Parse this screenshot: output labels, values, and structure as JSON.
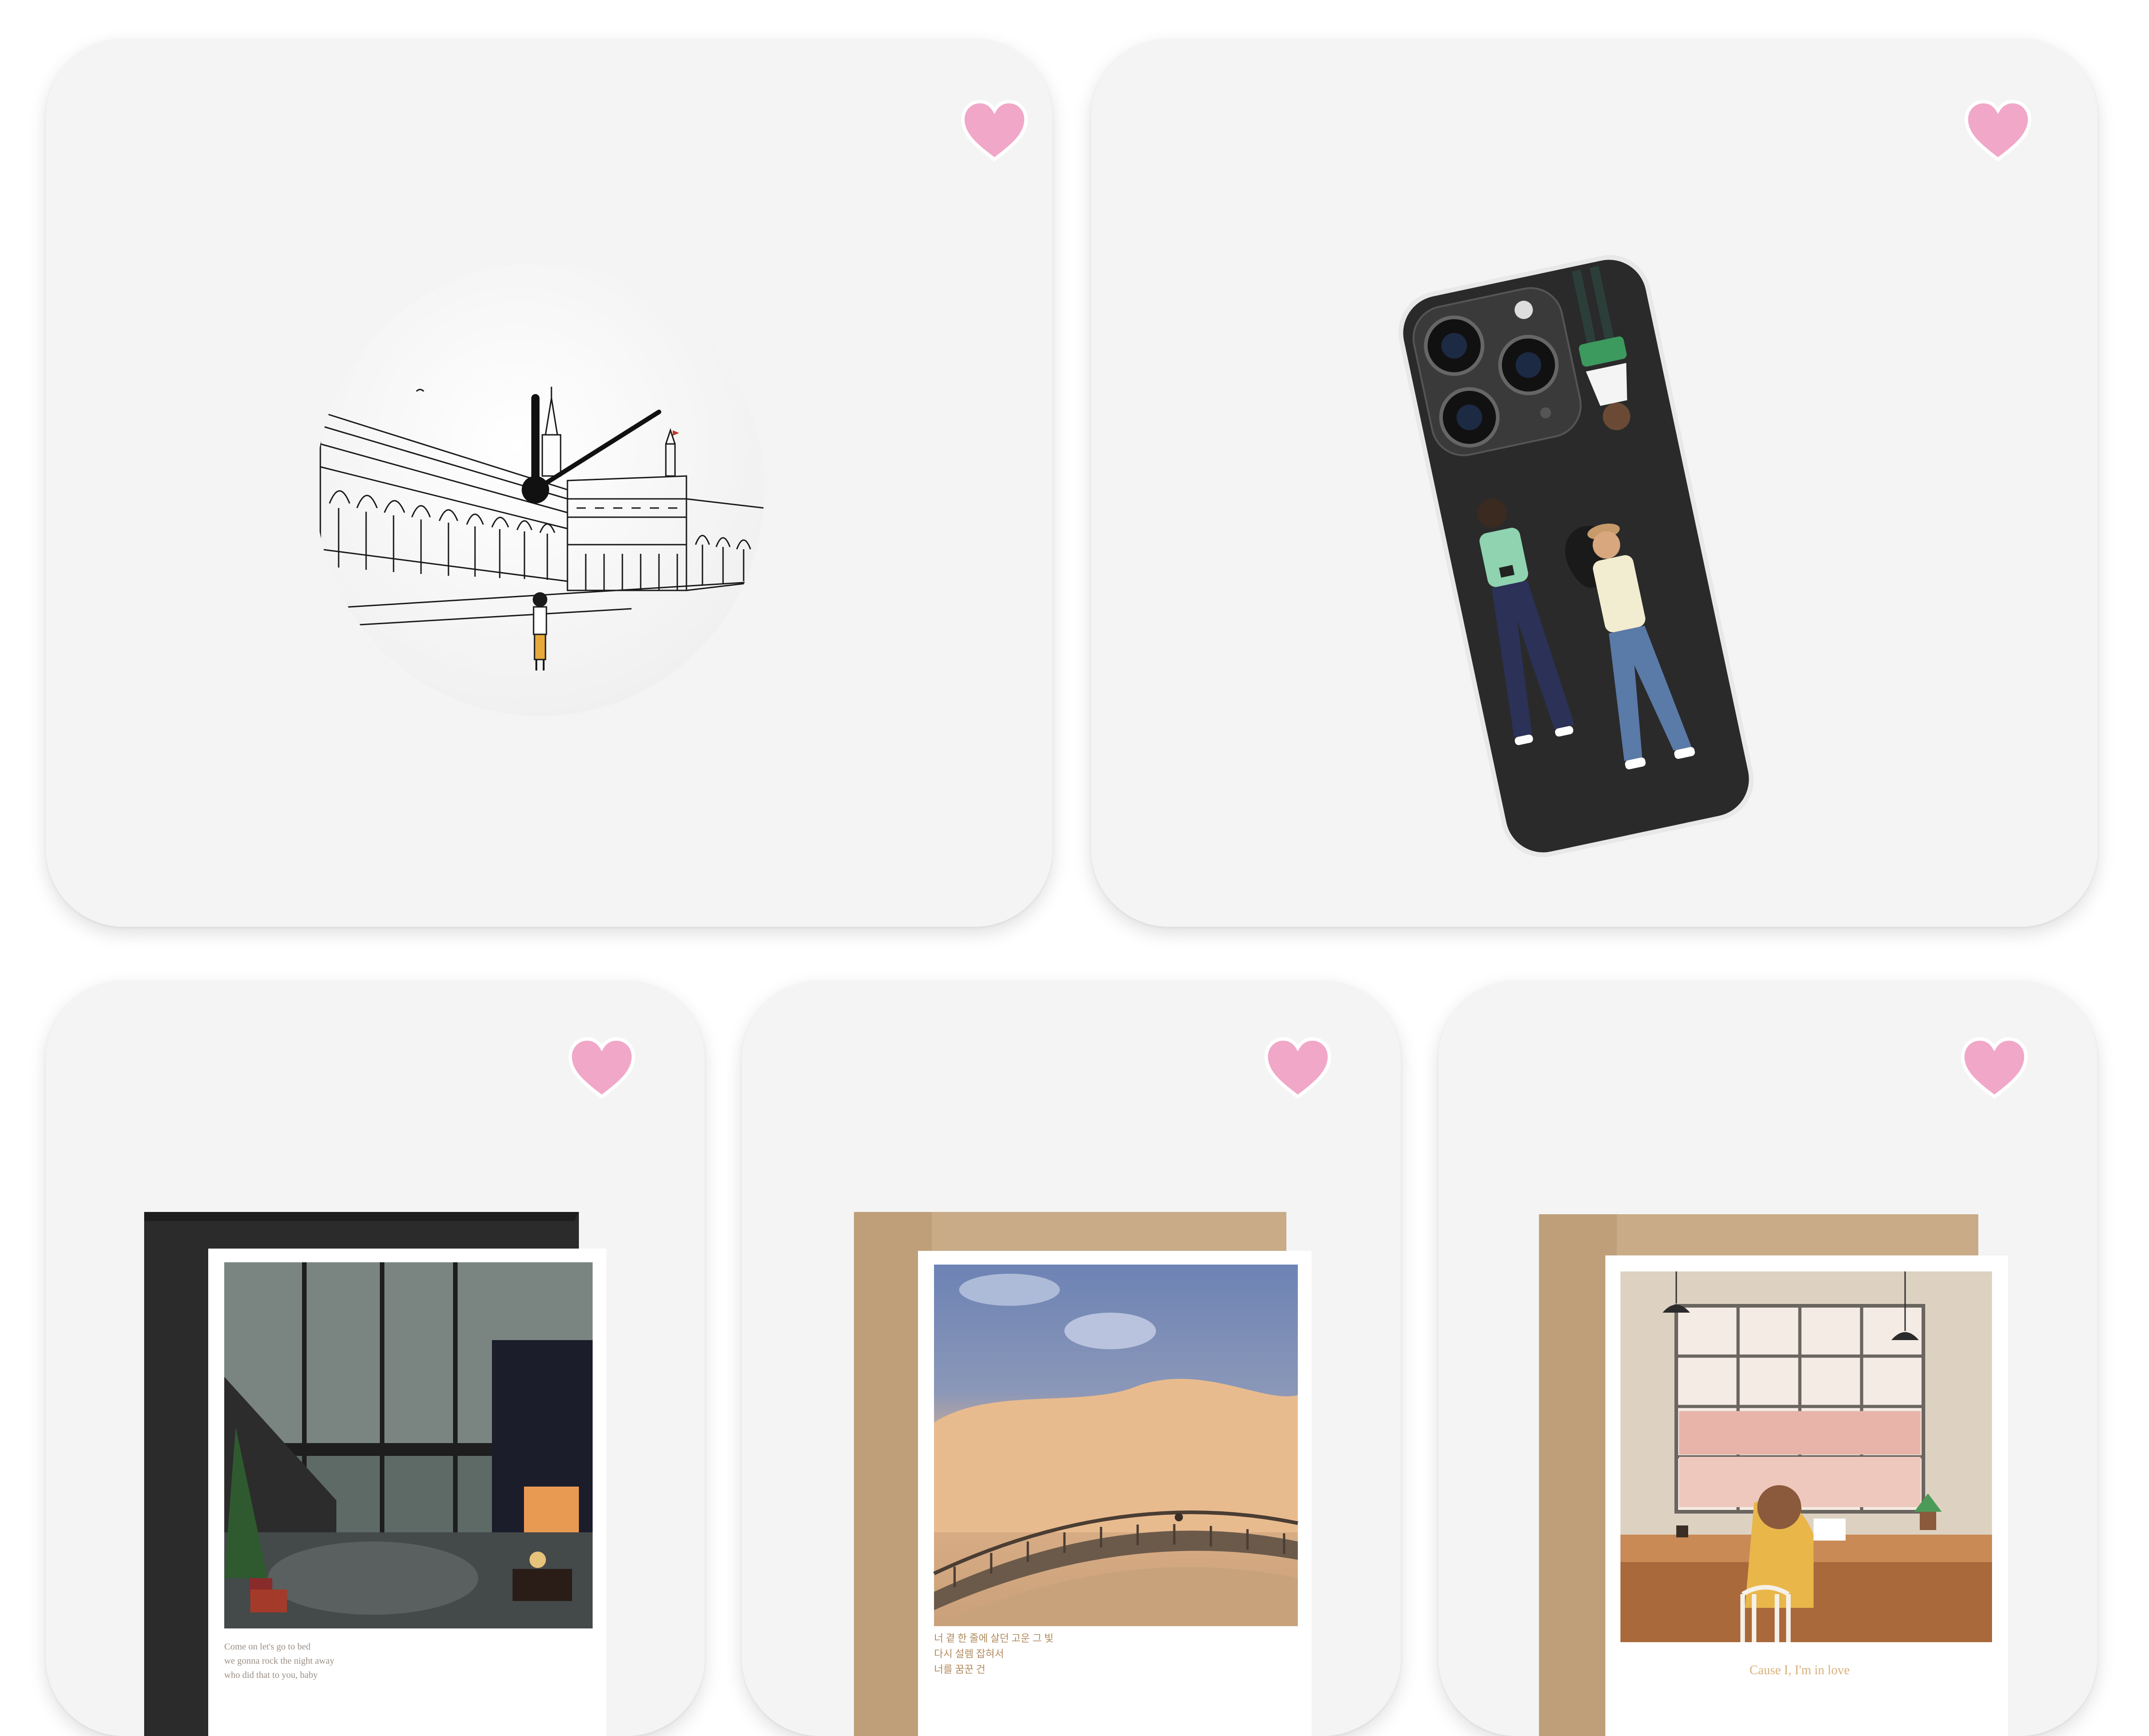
{
  "colors": {
    "card_background": "#f4f4f4",
    "favorite_heart": "#f1a7c8",
    "page_background": "#ffffff"
  },
  "products": [
    {
      "name": "Illustrated wall clock",
      "icon": "wall-clock-illustration",
      "favorite_icon": "heart-icon"
    },
    {
      "name": "Illustrated clear phone case",
      "icon": "phone-case-illustration",
      "favorite_icon": "heart-icon"
    },
    {
      "name": "Christmas window greeting card",
      "icon": "greeting-card-christmas",
      "favorite_icon": "heart-icon",
      "card_text": "Come on let's go to bed\nwe gonna rock the night away\nwho did that to you, baby"
    },
    {
      "name": "Sunset bridge greeting card",
      "icon": "greeting-card-bridge",
      "favorite_icon": "heart-icon",
      "card_text": "너 곁 한 줄에 살던 고운 그 빛\n다시 설렘 잡혀서\n너를 꿈꾼 건"
    },
    {
      "name": "Cafe window greeting card",
      "icon": "greeting-card-cafe",
      "favorite_icon": "heart-icon",
      "card_text": "Cause I, I'm in love"
    }
  ]
}
